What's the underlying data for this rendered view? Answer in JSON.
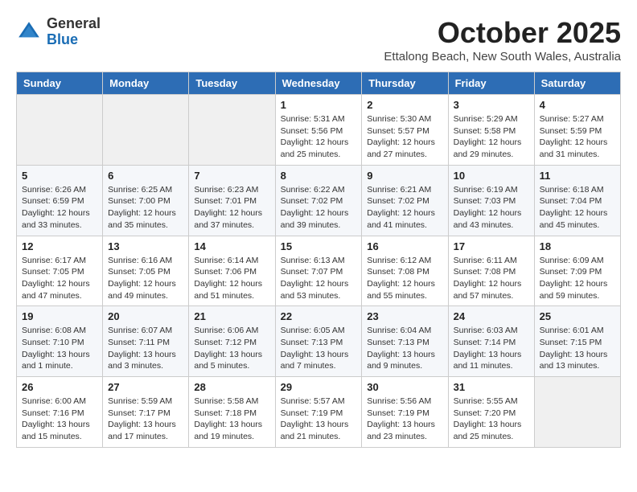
{
  "header": {
    "logo_line1": "General",
    "logo_line2": "Blue",
    "month": "October 2025",
    "location": "Ettalong Beach, New South Wales, Australia"
  },
  "weekdays": [
    "Sunday",
    "Monday",
    "Tuesday",
    "Wednesday",
    "Thursday",
    "Friday",
    "Saturday"
  ],
  "weeks": [
    [
      {
        "day": "",
        "empty": true
      },
      {
        "day": "",
        "empty": true
      },
      {
        "day": "",
        "empty": true
      },
      {
        "day": "1",
        "sunrise": "5:31 AM",
        "sunset": "5:56 PM",
        "daylight": "12 hours and 25 minutes."
      },
      {
        "day": "2",
        "sunrise": "5:30 AM",
        "sunset": "5:57 PM",
        "daylight": "12 hours and 27 minutes."
      },
      {
        "day": "3",
        "sunrise": "5:29 AM",
        "sunset": "5:58 PM",
        "daylight": "12 hours and 29 minutes."
      },
      {
        "day": "4",
        "sunrise": "5:27 AM",
        "sunset": "5:59 PM",
        "daylight": "12 hours and 31 minutes."
      }
    ],
    [
      {
        "day": "5",
        "sunrise": "6:26 AM",
        "sunset": "6:59 PM",
        "daylight": "12 hours and 33 minutes."
      },
      {
        "day": "6",
        "sunrise": "6:25 AM",
        "sunset": "7:00 PM",
        "daylight": "12 hours and 35 minutes."
      },
      {
        "day": "7",
        "sunrise": "6:23 AM",
        "sunset": "7:01 PM",
        "daylight": "12 hours and 37 minutes."
      },
      {
        "day": "8",
        "sunrise": "6:22 AM",
        "sunset": "7:02 PM",
        "daylight": "12 hours and 39 minutes."
      },
      {
        "day": "9",
        "sunrise": "6:21 AM",
        "sunset": "7:02 PM",
        "daylight": "12 hours and 41 minutes."
      },
      {
        "day": "10",
        "sunrise": "6:19 AM",
        "sunset": "7:03 PM",
        "daylight": "12 hours and 43 minutes."
      },
      {
        "day": "11",
        "sunrise": "6:18 AM",
        "sunset": "7:04 PM",
        "daylight": "12 hours and 45 minutes."
      }
    ],
    [
      {
        "day": "12",
        "sunrise": "6:17 AM",
        "sunset": "7:05 PM",
        "daylight": "12 hours and 47 minutes."
      },
      {
        "day": "13",
        "sunrise": "6:16 AM",
        "sunset": "7:05 PM",
        "daylight": "12 hours and 49 minutes."
      },
      {
        "day": "14",
        "sunrise": "6:14 AM",
        "sunset": "7:06 PM",
        "daylight": "12 hours and 51 minutes."
      },
      {
        "day": "15",
        "sunrise": "6:13 AM",
        "sunset": "7:07 PM",
        "daylight": "12 hours and 53 minutes."
      },
      {
        "day": "16",
        "sunrise": "6:12 AM",
        "sunset": "7:08 PM",
        "daylight": "12 hours and 55 minutes."
      },
      {
        "day": "17",
        "sunrise": "6:11 AM",
        "sunset": "7:08 PM",
        "daylight": "12 hours and 57 minutes."
      },
      {
        "day": "18",
        "sunrise": "6:09 AM",
        "sunset": "7:09 PM",
        "daylight": "12 hours and 59 minutes."
      }
    ],
    [
      {
        "day": "19",
        "sunrise": "6:08 AM",
        "sunset": "7:10 PM",
        "daylight": "13 hours and 1 minute."
      },
      {
        "day": "20",
        "sunrise": "6:07 AM",
        "sunset": "7:11 PM",
        "daylight": "13 hours and 3 minutes."
      },
      {
        "day": "21",
        "sunrise": "6:06 AM",
        "sunset": "7:12 PM",
        "daylight": "13 hours and 5 minutes."
      },
      {
        "day": "22",
        "sunrise": "6:05 AM",
        "sunset": "7:13 PM",
        "daylight": "13 hours and 7 minutes."
      },
      {
        "day": "23",
        "sunrise": "6:04 AM",
        "sunset": "7:13 PM",
        "daylight": "13 hours and 9 minutes."
      },
      {
        "day": "24",
        "sunrise": "6:03 AM",
        "sunset": "7:14 PM",
        "daylight": "13 hours and 11 minutes."
      },
      {
        "day": "25",
        "sunrise": "6:01 AM",
        "sunset": "7:15 PM",
        "daylight": "13 hours and 13 minutes."
      }
    ],
    [
      {
        "day": "26",
        "sunrise": "6:00 AM",
        "sunset": "7:16 PM",
        "daylight": "13 hours and 15 minutes."
      },
      {
        "day": "27",
        "sunrise": "5:59 AM",
        "sunset": "7:17 PM",
        "daylight": "13 hours and 17 minutes."
      },
      {
        "day": "28",
        "sunrise": "5:58 AM",
        "sunset": "7:18 PM",
        "daylight": "13 hours and 19 minutes."
      },
      {
        "day": "29",
        "sunrise": "5:57 AM",
        "sunset": "7:19 PM",
        "daylight": "13 hours and 21 minutes."
      },
      {
        "day": "30",
        "sunrise": "5:56 AM",
        "sunset": "7:19 PM",
        "daylight": "13 hours and 23 minutes."
      },
      {
        "day": "31",
        "sunrise": "5:55 AM",
        "sunset": "7:20 PM",
        "daylight": "13 hours and 25 minutes."
      },
      {
        "day": "",
        "empty": true
      }
    ]
  ]
}
